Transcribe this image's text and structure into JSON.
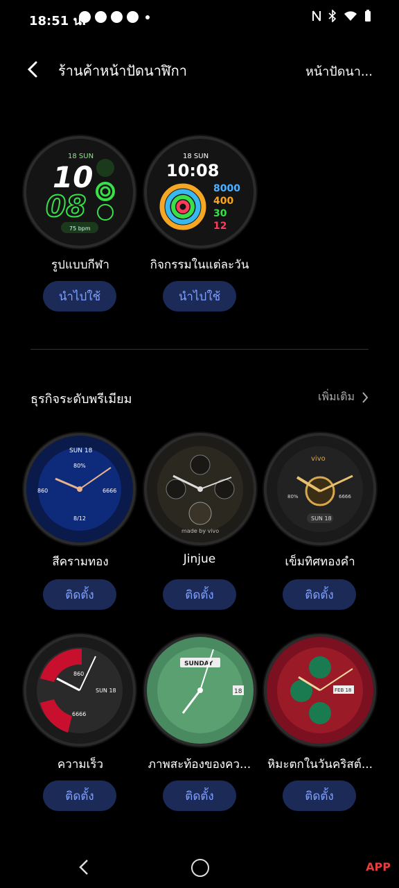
{
  "status_bar": {
    "time": "18:51 น."
  },
  "header": {
    "title": "ร้านค้าหน้าปัดนาฬิกา",
    "right_tab": "หน้าปัดนา..."
  },
  "featured": [
    {
      "name": "รูปแบบกีฬา",
      "button": "นำไปใช้",
      "date": "18 SUN",
      "hour": "10",
      "minute": "08",
      "bpm": "75 bpm"
    },
    {
      "name": "กิจกรรมในแต่ละวัน",
      "button": "นำไปใช้",
      "date": "18 SUN",
      "time": "10:08",
      "stats": [
        "8000",
        "400",
        "30",
        "12"
      ]
    }
  ],
  "section": {
    "title": "ธุรกิจระดับพรีเมียม",
    "more": "เพิ่มเติม"
  },
  "premium": [
    {
      "name": "สีครามทอง",
      "button": "ติดตั้ง",
      "date": "SUN 18",
      "pct": "80%",
      "left": "860",
      "right": "6666",
      "bottom": "8/12"
    },
    {
      "name": "Jinjue",
      "button": "ติดตั้ง",
      "brand": "made by vivo"
    },
    {
      "name": "เข็มทิศทองคำ",
      "button": "ติดตั้ง",
      "brand": "vivo",
      "pct": "80%",
      "right": "6666",
      "date": "SUN 18"
    },
    {
      "name": "ความเร็ว",
      "button": "ติดตั้ง",
      "top": "860",
      "side": "SUN 18",
      "bottom": "6666"
    },
    {
      "name": "ภาพสะท้องของคว...",
      "button": "ติดตั้ง",
      "day": "SUNDAY",
      "date": "18"
    },
    {
      "name": "หิมะตกในวันคริสต์...",
      "button": "ติดตั้ง",
      "date": "FEB 18"
    }
  ],
  "watermark": "APP",
  "colors": {
    "accent_button_bg": "#1b2a57",
    "accent_button_text": "#7fa0ff",
    "sport_green": "#39e04a"
  }
}
